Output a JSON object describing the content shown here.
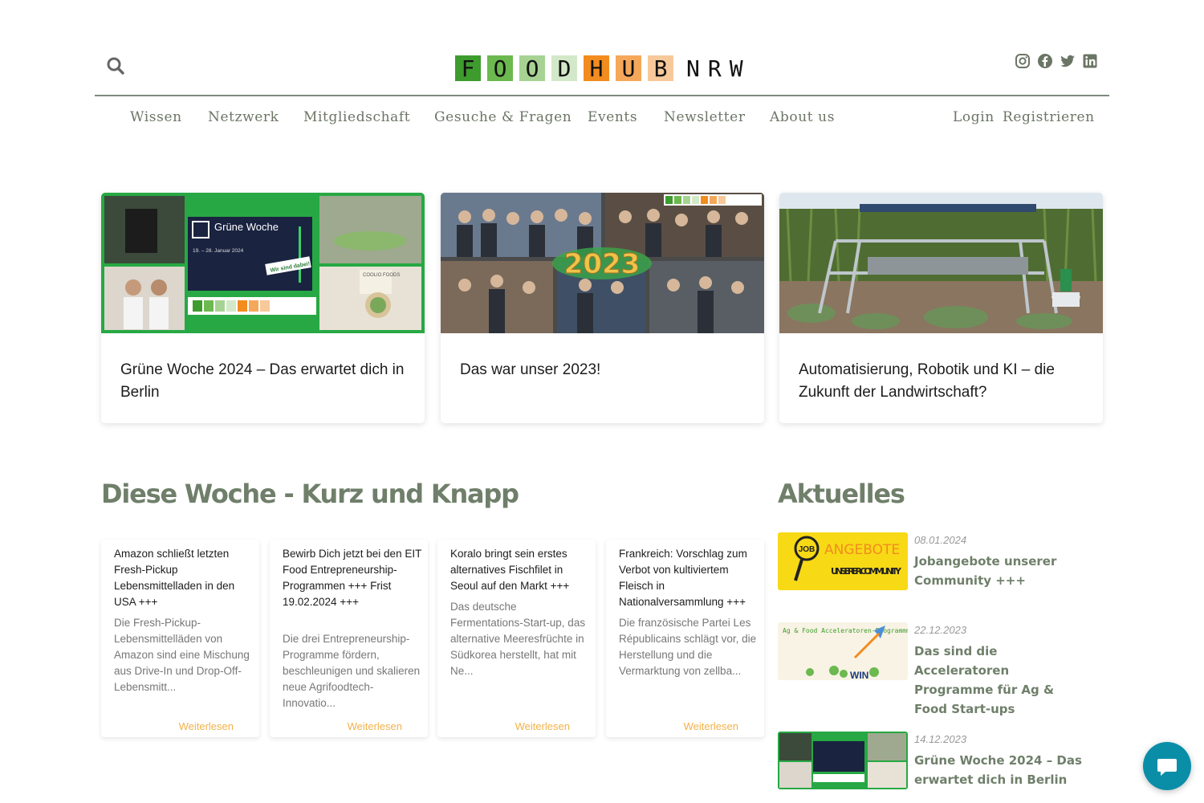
{
  "header": {
    "logo_letters": [
      "F",
      "O",
      "O",
      "D",
      "H",
      "U",
      "B"
    ],
    "logo_colors": [
      "#3e9b2e",
      "#6cb94f",
      "#a6d393",
      "#d3e8c8",
      "#f28c1e",
      "#f5a85a",
      "#f7c99a"
    ],
    "logo_suffix": "NRW",
    "search_icon": "search-icon",
    "social_icons": [
      "instagram-icon",
      "facebook-icon",
      "twitter-icon",
      "linkedin-icon"
    ]
  },
  "nav": {
    "items": [
      "Wissen",
      "Netzwerk",
      "Mitgliedschaft",
      "Gesuche & Fragen",
      "Events",
      "Newsletter",
      "About us"
    ],
    "login": "Login",
    "register": "Registrieren"
  },
  "featured": [
    {
      "title": "Grüne Woche 2024 – Das erwartet dich in Berlin"
    },
    {
      "title": "Das war unser 2023!"
    },
    {
      "title": "Automatisierung, Robotik und KI – die Zukunft der Landwirtschaft?"
    }
  ],
  "week": {
    "heading": "Diese Woche - Kurz und Knapp",
    "more_label": "Weiterlesen",
    "cards": [
      {
        "title": "Amazon schließt letzten Fresh-Pickup Lebensmittelladen in den USA +++",
        "excerpt": "Die Fresh-Pickup-Lebensmittelläden von Amazon sind eine Mischung aus Drive-In und Drop-Off-Lebensmitt..."
      },
      {
        "title": "Bewirb Dich jetzt bei den EIT Food Entrepreneurship-Programmen +++ Frist 19.02.2024 +++",
        "excerpt": "Die drei Entrepreneurship-Programme fördern, beschleunigen und skalieren neue Agrifoodtech-Innovatio..."
      },
      {
        "title": "Koralo bringt sein erstes alternatives Fischfilet in Seoul auf den Markt +++",
        "excerpt": "Das deutsche Fermentations-Start-up, das alternative Meeresfrüchte in Südkorea herstellt, hat mit Ne..."
      },
      {
        "title": "Frankreich: Vorschlag zum Verbot von kultiviertem Fleisch in Nationalversammlung +++",
        "excerpt": "Die französische Partei Les Républicains schlägt vor, die Herstellung und die Vermarktung von zellba..."
      }
    ]
  },
  "aktuelles": {
    "heading": "Aktuelles",
    "items": [
      {
        "date": "08.01.2024",
        "title": "Jobangebote unserer Community +++",
        "thumb_text": "ANGEBOTE",
        "thumb_sub": "UNSERER COMMUNITY",
        "thumb_job": "JOB"
      },
      {
        "date": "22.12.2023",
        "title": "Das sind die Acceleratoren Programme für Ag & Food Start-ups",
        "thumb_text": "Ag & Food Acceleratoren-Programmme",
        "thumb_win": "WIN"
      },
      {
        "date": "14.12.2023",
        "title": "Grüne Woche 2024 – Das erwartet dich in Berlin"
      }
    ]
  },
  "images": {
    "gw_title": "Grüne Woche",
    "gw_dates": "19. – 28. Januar 2024",
    "gw_sticker": "Wir sind dabei!",
    "gw_brand": "COOLIO FOODS",
    "year_badge": "2023"
  },
  "chat_icon": "chat-bubble-icon"
}
